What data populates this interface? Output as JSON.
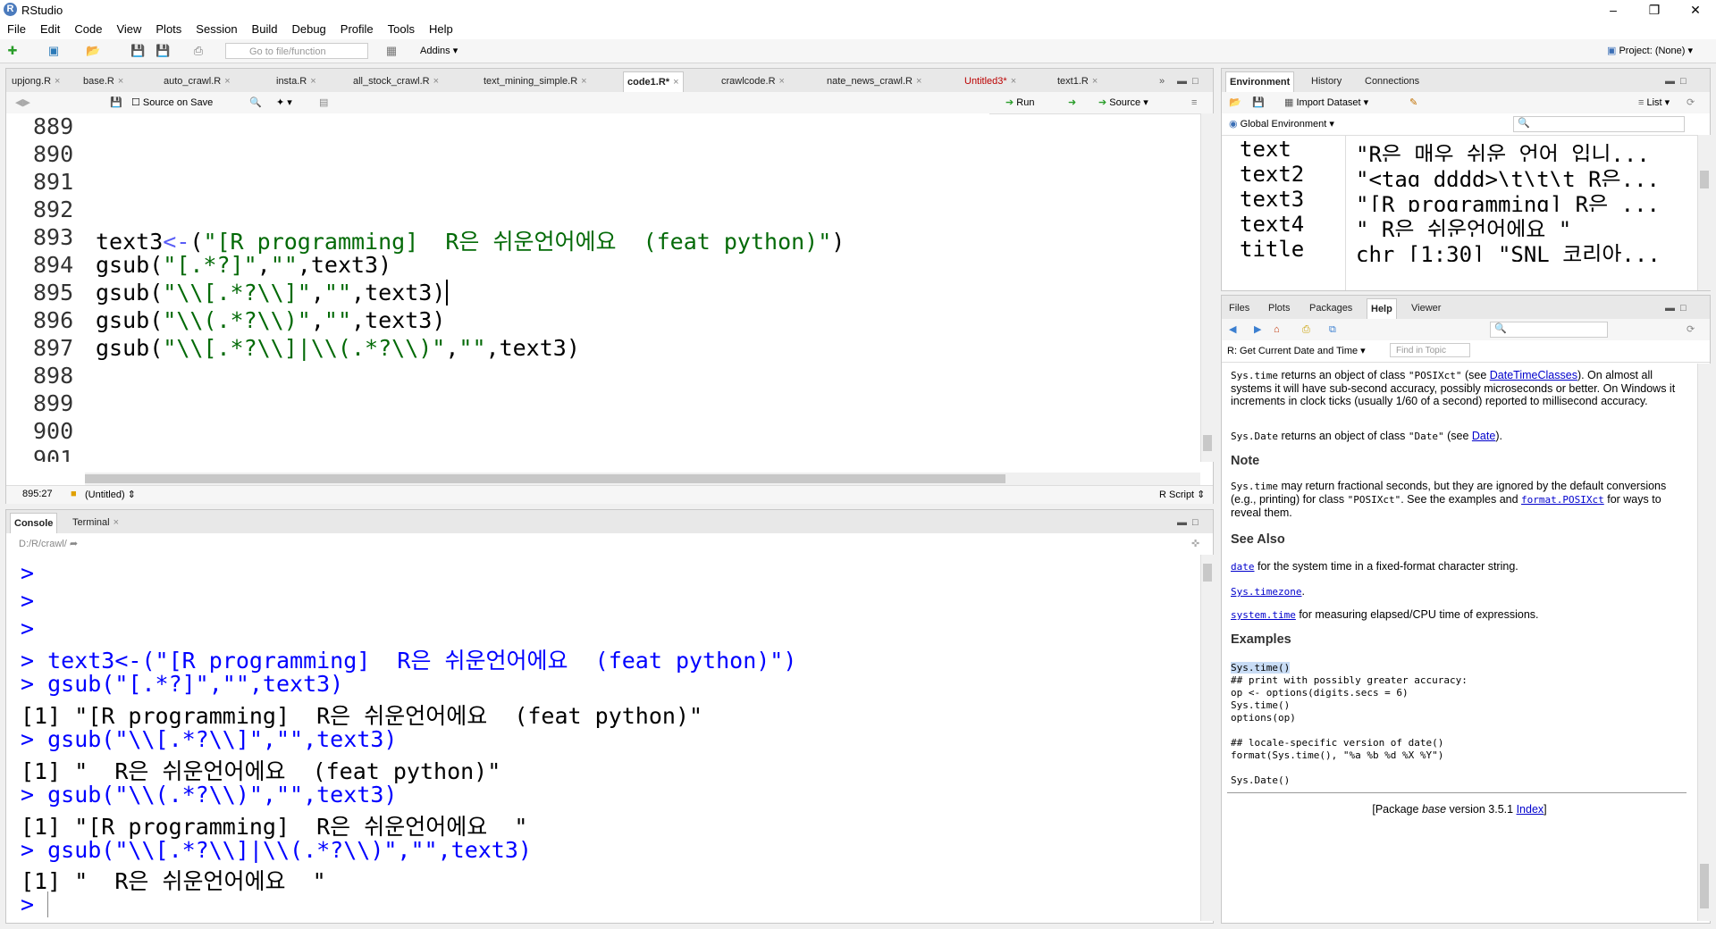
{
  "window": {
    "title": "RStudio"
  },
  "menu": [
    "File",
    "Edit",
    "Code",
    "View",
    "Plots",
    "Session",
    "Build",
    "Debug",
    "Profile",
    "Tools",
    "Help"
  ],
  "toolbar": {
    "goto_placeholder": "Go to file/function",
    "addins": "Addins",
    "project": "Project: (None)"
  },
  "editor": {
    "tabs": [
      "upjong.R",
      "base.R",
      "auto_crawl.R",
      "insta.R",
      "all_stock_crawl.R",
      "text_mining_simple.R",
      "code1.R*",
      "crawlcode.R",
      "nate_news_crawl.R",
      "Untitled3*",
      "text1.R"
    ],
    "active_tab": "code1.R*",
    "source_on_save": "Source on Save",
    "run": "Run",
    "source": "Source",
    "line_numbers": [
      "889",
      "890",
      "891",
      "892",
      "893",
      "894",
      "895",
      "896",
      "897",
      "898",
      "899",
      "900",
      "901"
    ],
    "lines": {
      "l893": {
        "a": "text3",
        "b": "<-",
        "c": "(",
        "d": "\"[R programming]  R은 쉬운언어에요  (feat python)\"",
        "e": ")"
      },
      "l894": {
        "a": "gsub(",
        "b": "\"[.*?]\"",
        "c": ",",
        "d": "\"\"",
        "e": ",text3)"
      },
      "l895": {
        "a": "gsub(",
        "b": "\"\\\\[.*?\\\\]\"",
        "c": ",",
        "d": "\"\"",
        "e": ",text3)"
      },
      "l896": {
        "a": "gsub(",
        "b": "\"\\\\(.*?\\\\)\"",
        "c": ",",
        "d": "\"\"",
        "e": ",text3)"
      },
      "l897": {
        "a": "gsub(",
        "b": "\"\\\\[.*?\\\\]|\\\\(.*?\\\\)\"",
        "c": ",",
        "d": "\"\"",
        "e": ",text3)"
      }
    },
    "status_pos": "895:27",
    "status_scope": "(Untitled)",
    "status_type": "R Script"
  },
  "console": {
    "tabs": [
      "Console",
      "Terminal"
    ],
    "path": "D:/R/crawl/",
    "lines": [
      {
        "t": "cmd",
        "s": ">"
      },
      {
        "t": "cmd",
        "s": ">"
      },
      {
        "t": "cmd",
        "s": ">"
      },
      {
        "t": "cmd",
        "s": "> text3<-(\"[R programming]  R은 쉬운언어에요  (feat python)\")"
      },
      {
        "t": "cmd",
        "s": "> gsub(\"[.*?]\",\"\",text3)"
      },
      {
        "t": "res",
        "s": "[1] \"[R programming]  R은 쉬운언어에요  (feat python)\""
      },
      {
        "t": "cmd",
        "s": "> gsub(\"\\\\[.*?\\\\]\",\"\",text3)"
      },
      {
        "t": "res",
        "s": "[1] \"  R은 쉬운언어에요  (feat python)\""
      },
      {
        "t": "cmd",
        "s": "> gsub(\"\\\\(.*?\\\\)\",\"\",text3)"
      },
      {
        "t": "res",
        "s": "[1] \"[R programming]  R은 쉬운언어에요  \""
      },
      {
        "t": "cmd",
        "s": "> gsub(\"\\\\[.*?\\\\]|\\\\(.*?\\\\)\",\"\",text3)"
      },
      {
        "t": "res",
        "s": "[1] \"  R은 쉬운언어에요  \""
      },
      {
        "t": "cmd",
        "s": ">"
      }
    ]
  },
  "environment": {
    "tabs": [
      "Environment",
      "History",
      "Connections"
    ],
    "import": "Import Dataset",
    "list": "List",
    "scope": "Global Environment",
    "rows": [
      {
        "name": "text",
        "value": "\"R은 매우 쉬운 언어 입니..."
      },
      {
        "name": "text2",
        "value": "\"<tag dddd>\\t\\t\\t R은..."
      },
      {
        "name": "text3",
        "value": "\"[R programming] R은 ..."
      },
      {
        "name": "text4",
        "value": "\" R은 쉬운언어에요 \""
      },
      {
        "name": "title",
        "value": "chr [1:30] \"SNL 코리아..."
      }
    ]
  },
  "help": {
    "tabs": [
      "Files",
      "Plots",
      "Packages",
      "Help",
      "Viewer"
    ],
    "topic": "R: Get Current Date and Time",
    "find_placeholder": "Find in Topic",
    "p1_code": "Sys.time",
    "p1_a": " returns an object of class ",
    "p1_code2": "\"POSIXct\"",
    "p1_b": " (see ",
    "p1_link": "DateTimeClasses",
    "p1_c": "). On almost all systems it will have sub-second accuracy, possibly microseconds or better. On Windows it increments in clock ticks (usually 1/60 of a second) reported to millisecond accuracy.",
    "p2_code": "Sys.Date",
    "p2_a": " returns an object of class ",
    "p2_code2": "\"Date\"",
    "p2_b": " (see ",
    "p2_link": "Date",
    "p2_c": ").",
    "note_h": "Note",
    "note_code": "Sys.time",
    "note_a": " may return fractional seconds, but they are ignored by the default conversions (e.g., printing) for class ",
    "note_code2": "\"POSIXct\"",
    "note_b": ". See the examples and ",
    "note_link": "format.POSIXct",
    "note_c": " for ways to reveal them.",
    "seealso_h": "See Also",
    "sa1_link": "date",
    "sa1_text": " for the system time in a fixed-format character string.",
    "sa2_link": "Sys.timezone",
    "sa2_text": ".",
    "sa3_link": "system.time",
    "sa3_text": " for measuring elapsed/CPU time of expressions.",
    "examples_h": "Examples",
    "ex": [
      "Sys.time()",
      "## print with possibly greater accuracy:",
      "op <- options(digits.secs = 6)",
      "Sys.time()",
      "options(op)",
      "",
      "## locale-specific version of date()",
      "format(Sys.time(), \"%a %b %d %X %Y\")",
      "",
      "Sys.Date()"
    ],
    "footer_a": "[Package ",
    "footer_pkg": "base",
    "footer_b": " version 3.5.1 ",
    "footer_link": "Index",
    "footer_c": "]"
  }
}
